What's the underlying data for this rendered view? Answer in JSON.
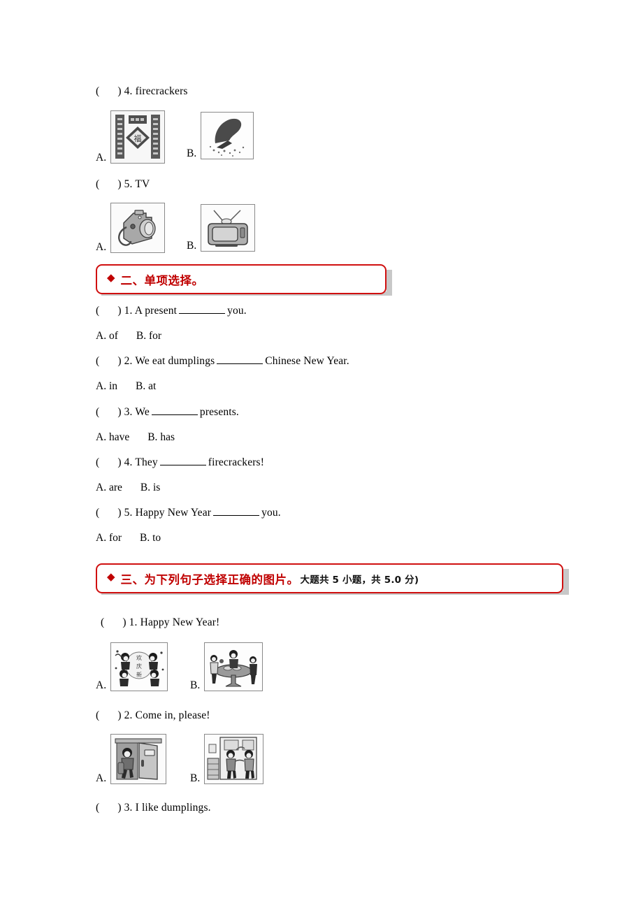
{
  "document": {
    "type": "worksheet-scan",
    "page_background": "#ffffff",
    "accent_red": "#c00000",
    "border_red": "#d01010"
  },
  "section_one_tail": {
    "questions": [
      {
        "id": "q4",
        "prefix": "(",
        "suffix": ")",
        "number": "4.",
        "text": "firecrackers",
        "options": [
          {
            "label": "A.",
            "image_name": "spring-festival-couplets-picture"
          },
          {
            "label": "B.",
            "image_name": "firecracker-explosion-picture"
          }
        ]
      },
      {
        "id": "q5",
        "prefix": "(",
        "suffix": ")",
        "number": "5.",
        "text": "TV",
        "options": [
          {
            "label": "A.",
            "image_name": "camera-picture"
          },
          {
            "label": "B.",
            "image_name": "television-picture"
          }
        ]
      }
    ]
  },
  "section_two": {
    "bullet": "◆",
    "title_red": "二、单项选择。",
    "title_black": "",
    "questions": [
      {
        "id": "s2q1",
        "number": "1.",
        "before": "A present",
        "after": "you.",
        "options_line": [
          {
            "label": "A.",
            "text": "of"
          },
          {
            "label": "B.",
            "text": "for"
          }
        ]
      },
      {
        "id": "s2q2",
        "number": "2.",
        "before": "We eat dumplings",
        "after": "Chinese New Year.",
        "options_line": [
          {
            "label": "A.",
            "text": "in"
          },
          {
            "label": "B.",
            "text": "at"
          }
        ]
      },
      {
        "id": "s2q3",
        "number": "3.",
        "before": "We",
        "after": "presents.",
        "options_line": [
          {
            "label": "A.",
            "text": "have"
          },
          {
            "label": "B.",
            "text": "has"
          }
        ]
      },
      {
        "id": "s2q4",
        "number": "4.",
        "before": "They",
        "after": "firecrackers!",
        "options_line": [
          {
            "label": "A.",
            "text": "are"
          },
          {
            "label": "B.",
            "text": "is"
          }
        ]
      },
      {
        "id": "s2q5",
        "number": "5.",
        "before": "Happy New Year",
        "after": "you.",
        "options_line": [
          {
            "label": "A.",
            "text": "for"
          },
          {
            "label": "B.",
            "text": "to"
          }
        ]
      }
    ]
  },
  "section_three": {
    "bullet": "◆",
    "title_red": "三、为下列句子选择正确的图片。",
    "title_black": "大题共 5 小题，共 5.0 分)",
    "questions": [
      {
        "id": "s3q1",
        "number": "1.",
        "text": "Happy New Year!",
        "options": [
          {
            "label": "A.",
            "image_name": "children-celebrating-new-year-picture"
          },
          {
            "label": "B.",
            "image_name": "family-at-dinner-table-picture"
          }
        ]
      },
      {
        "id": "s3q2",
        "number": "2.",
        "text": "Come in, please!",
        "options": [
          {
            "label": "A.",
            "image_name": "boy-entering-door-picture"
          },
          {
            "label": "B.",
            "image_name": "guests-greeting-at-doorway-picture"
          }
        ]
      },
      {
        "id": "s3q3",
        "number": "3.",
        "text": "I like dumplings.",
        "options": []
      }
    ]
  }
}
